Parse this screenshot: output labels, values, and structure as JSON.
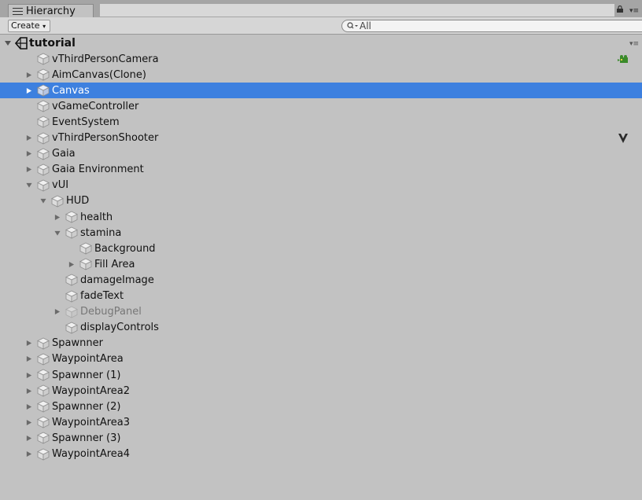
{
  "window": {
    "tab_label": "Hierarchy",
    "create_label": "Create",
    "search_value": "All",
    "scene_name": "tutorial"
  },
  "items": [
    {
      "label": "vThirdPersonCamera",
      "depth": 1,
      "expander": "none",
      "icon": "camera-icon"
    },
    {
      "label": "AimCanvas(Clone)",
      "depth": 1,
      "expander": "collapsed"
    },
    {
      "label": "Canvas",
      "depth": 1,
      "expander": "collapsed",
      "selected": true
    },
    {
      "label": "vGameController",
      "depth": 1,
      "expander": "none"
    },
    {
      "label": "EventSystem",
      "depth": 1,
      "expander": "none"
    },
    {
      "label": "vThirdPersonShooter",
      "depth": 1,
      "expander": "collapsed",
      "icon": "shooter-icon"
    },
    {
      "label": "Gaia",
      "depth": 1,
      "expander": "collapsed"
    },
    {
      "label": "Gaia Environment",
      "depth": 1,
      "expander": "collapsed"
    },
    {
      "label": "vUI",
      "depth": 1,
      "expander": "expanded"
    },
    {
      "label": "HUD",
      "depth": 2,
      "expander": "expanded"
    },
    {
      "label": "health",
      "depth": 3,
      "expander": "collapsed"
    },
    {
      "label": "stamina",
      "depth": 3,
      "expander": "expanded"
    },
    {
      "label": "Background",
      "depth": 4,
      "expander": "none"
    },
    {
      "label": "Fill Area",
      "depth": 4,
      "expander": "collapsed"
    },
    {
      "label": "damageImage",
      "depth": 3,
      "expander": "none"
    },
    {
      "label": "fadeText",
      "depth": 3,
      "expander": "none"
    },
    {
      "label": "DebugPanel",
      "depth": 3,
      "expander": "collapsed",
      "disabled": true
    },
    {
      "label": "displayControls",
      "depth": 3,
      "expander": "none"
    },
    {
      "label": "Spawnner",
      "depth": 1,
      "expander": "collapsed"
    },
    {
      "label": "WaypointArea",
      "depth": 1,
      "expander": "collapsed"
    },
    {
      "label": "Spawnner (1)",
      "depth": 1,
      "expander": "collapsed"
    },
    {
      "label": "WaypointArea2",
      "depth": 1,
      "expander": "collapsed"
    },
    {
      "label": "Spawnner (2)",
      "depth": 1,
      "expander": "collapsed"
    },
    {
      "label": "WaypointArea3",
      "depth": 1,
      "expander": "collapsed"
    },
    {
      "label": "Spawnner (3)",
      "depth": 1,
      "expander": "collapsed"
    },
    {
      "label": "WaypointArea4",
      "depth": 1,
      "expander": "collapsed"
    }
  ],
  "colors": {
    "panel_bg": "#c2c2c2",
    "selection": "#3d80df",
    "disabled_text": "#777777"
  }
}
